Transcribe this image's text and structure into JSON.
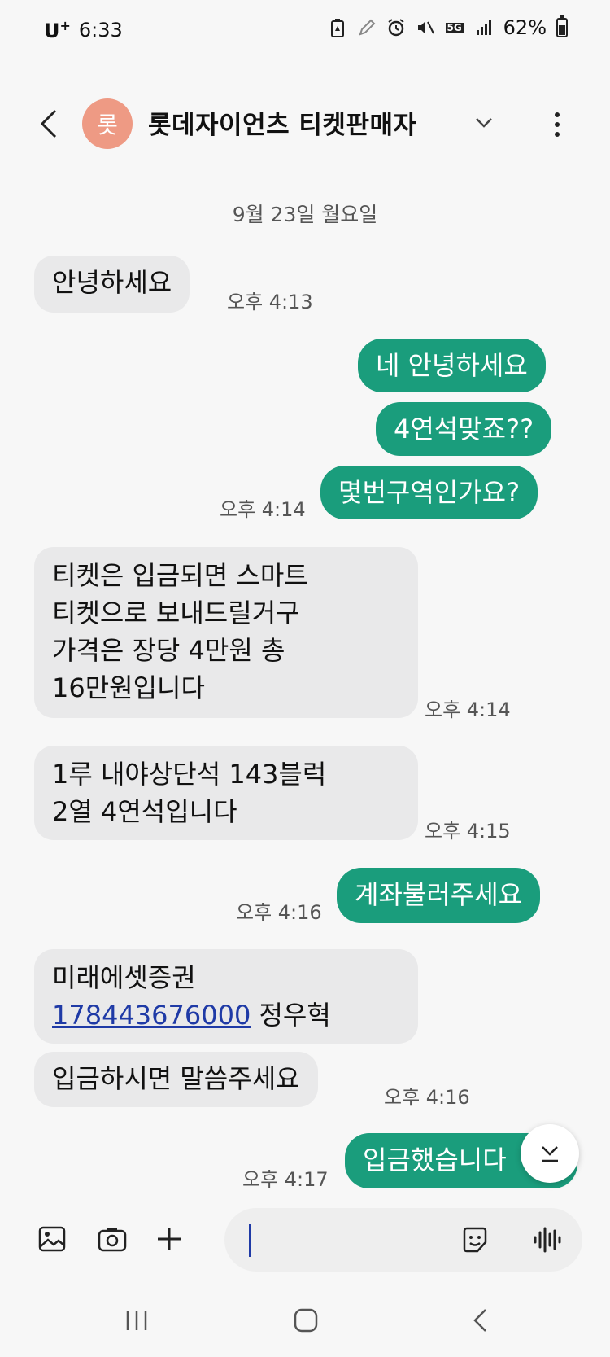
{
  "status": {
    "carrier": "U",
    "carrier_sup": "+",
    "time": "6:33",
    "network": "5G",
    "battery": "62%"
  },
  "header": {
    "avatar_char": "롯",
    "contact_name": "롯데자이언츠 티켓판매자"
  },
  "date_label": "9월 23일 월요일",
  "messages": {
    "m1": {
      "text": "안녕하세요",
      "time": "오후 4:13"
    },
    "m2": {
      "text": "네 안녕하세요"
    },
    "m3": {
      "text": "4연석맞죠??"
    },
    "m4": {
      "text": "몇번구역인가요?",
      "time": "오후 4:14"
    },
    "m5": {
      "lines": [
        "티켓은 입금되면 스마트",
        "티켓으로 보내드릴거구",
        "가격은 장당 4만원 총",
        "16만원입니다"
      ],
      "time": "오후 4:14"
    },
    "m6": {
      "lines": [
        "1루 내야상단석 143블럭",
        "2열 4연석입니다"
      ],
      "time": "오후 4:15"
    },
    "m7": {
      "text": "계좌불러주세요",
      "time": "오후 4:16"
    },
    "m8": {
      "line1": "미래에셋증권",
      "account": "178443676000",
      "name": "정우혁"
    },
    "m9": {
      "text": "입금하시면 말씀주세요",
      "time": "오후 4:16"
    },
    "m10": {
      "text": "입금했습니다",
      "time": "오후 4:17"
    }
  },
  "composer": {
    "placeholder": ""
  }
}
